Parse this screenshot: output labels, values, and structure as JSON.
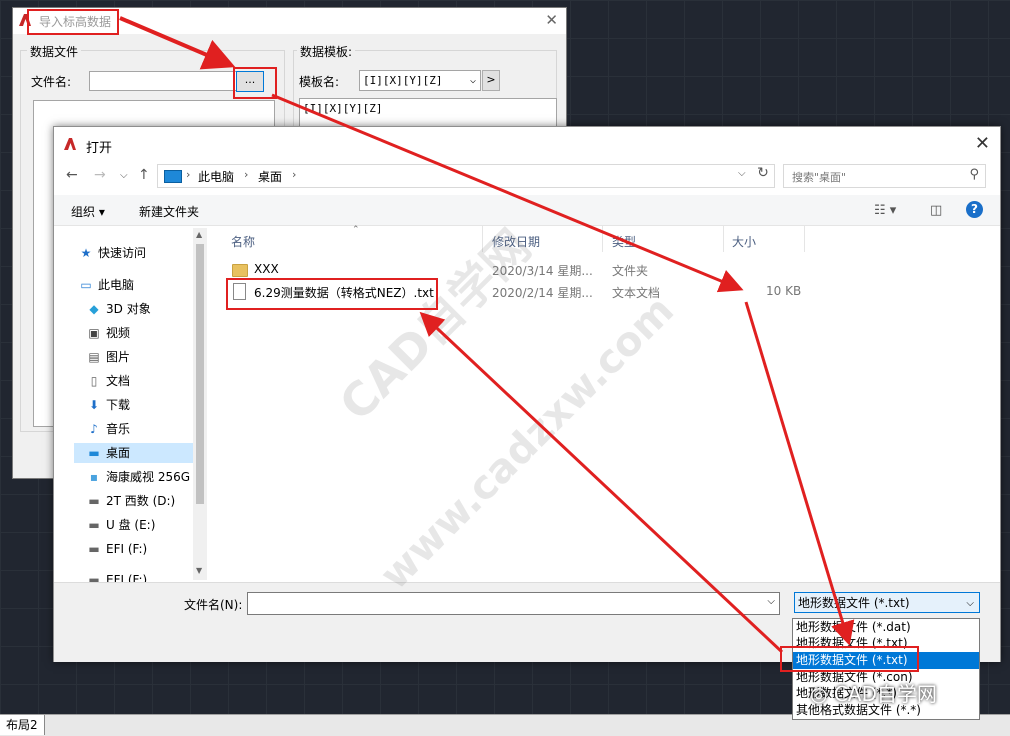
{
  "layout_tab": "布局2",
  "import_dialog": {
    "title": "导入标高数据",
    "data_group_label": "数据文件",
    "file_label": "文件名:",
    "browse_label": "...",
    "template_group_label": "数据模板:",
    "template_label": "模板名:",
    "template_value": "[I][X][Y][Z]",
    "template_arrow": ">",
    "template_text": "[I][X][Y][Z]"
  },
  "open_dialog": {
    "title": "打开",
    "breadcrumb": [
      "此电脑",
      "桌面"
    ],
    "search_placeholder": "搜索\"桌面\"",
    "toolbar": {
      "organize": "组织 ▾",
      "new_folder": "新建文件夹"
    },
    "nav_items": [
      {
        "label": "快速访问",
        "icon": "star-icon"
      },
      {
        "label": "此电脑",
        "icon": "computer-icon"
      },
      {
        "label": "3D 对象",
        "icon": "cube-icon"
      },
      {
        "label": "视频",
        "icon": "video-icon"
      },
      {
        "label": "图片",
        "icon": "picture-icon"
      },
      {
        "label": "文档",
        "icon": "document-icon"
      },
      {
        "label": "下载",
        "icon": "download-icon"
      },
      {
        "label": "音乐",
        "icon": "music-icon"
      },
      {
        "label": "桌面",
        "icon": "desktop-icon",
        "selected": true
      },
      {
        "label": "海康威视 256G",
        "icon": "drive-icon"
      },
      {
        "label": "2T 西数 (D:)",
        "icon": "drive-icon"
      },
      {
        "label": "U 盘 (E:)",
        "icon": "drive-icon"
      },
      {
        "label": "EFI (F:)",
        "icon": "drive-icon"
      },
      {
        "label": "EFI (F:)",
        "icon": "drive-icon"
      }
    ],
    "columns": [
      "名称",
      "修改日期",
      "类型",
      "大小"
    ],
    "files": [
      {
        "name": "XXX",
        "date": "2020/3/14 星期...",
        "type": "文件夹",
        "size": "",
        "kind": "folder"
      },
      {
        "name": "6.29测量数据（转格式NEZ）.txt",
        "date": "2020/2/14 星期...",
        "type": "文本文档",
        "size": "10 KB",
        "kind": "text"
      }
    ],
    "filename_label": "文件名(N):",
    "filename_value": "",
    "filetype_selected": "地形数据文件 (*.txt)",
    "filetype_options": [
      "地形数据文件 (*.dat)",
      "地形数据文件 (*.txt)",
      "地形数据文件 (*.txt)",
      "地形数据文件 (*.con)",
      "地形数据文件 (*.*)",
      "其他格式数据文件 (*.*)"
    ],
    "filetype_selected_index": 2
  },
  "watermarks": [
    "CAD自学网",
    "www.cadzxw.com"
  ],
  "wechat_mark": "CAD自学网",
  "colors": {
    "accent": "#0078d7",
    "highlight": "#e02020",
    "cad_bg": "#212630"
  }
}
